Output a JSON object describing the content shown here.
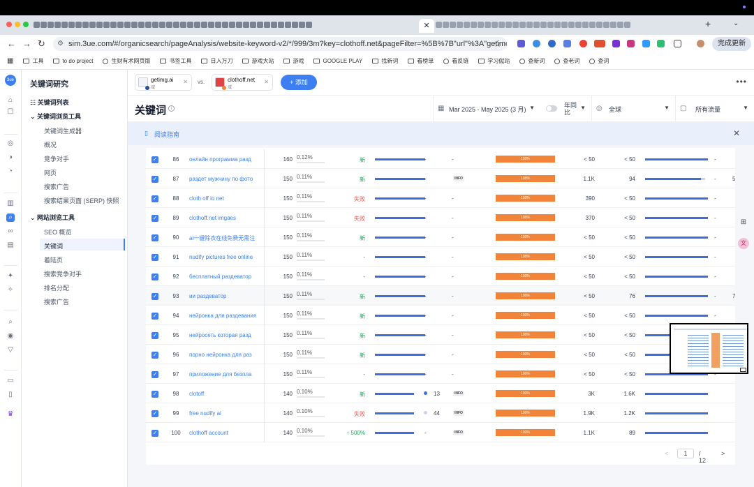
{
  "browser": {
    "url": "sim.3ue.com/#/organicsearch/pageAnalysis/website-keyword-v2/*/999/3m?key=clothoff.net&pageFilter=%5B%7B\"url\"%3A\"getimg.ai\"%2C\"sea...",
    "update_label": "完成更新",
    "active_tab_close": "✕",
    "new_tab": "+"
  },
  "bookmarks": [
    {
      "label": "工具",
      "icon": "folder-icon"
    },
    {
      "label": "to do project",
      "icon": "folder-icon"
    },
    {
      "label": "生财有术网页版",
      "icon": "globe-icon"
    },
    {
      "label": "书签工具",
      "icon": "folder-icon"
    },
    {
      "label": "日入万刀",
      "icon": "folder-icon"
    },
    {
      "label": "游戏大站",
      "icon": "folder-icon"
    },
    {
      "label": "游戏",
      "icon": "folder-icon"
    },
    {
      "label": "GOOGLE PLAY",
      "icon": "folder-icon"
    },
    {
      "label": "找新词",
      "icon": "folder-icon"
    },
    {
      "label": "看榜单",
      "icon": "folder-icon"
    },
    {
      "label": "看反链",
      "icon": "globe-icon"
    },
    {
      "label": "学习僦站",
      "icon": "folder-icon"
    },
    {
      "label": "查新词",
      "icon": "globe-icon"
    },
    {
      "label": "查老词",
      "icon": "globe-icon"
    },
    {
      "label": "查词",
      "icon": "globe-icon"
    }
  ],
  "sidebar": {
    "title": "关键词研究",
    "keyword_list": "关键词列表",
    "kw_browse_tools": "关键词浏览工具",
    "kw_tools": [
      "关键词生成器",
      "概况",
      "竞争对手",
      "网页",
      "搜索广告",
      "搜索结果页面 (SERP) 快照"
    ],
    "site_browse_tools": "网站浏览工具",
    "site_tools": [
      "SEO 概览",
      "关键词",
      "着陆页",
      "搜索竞争对手",
      "排名分配",
      "搜索广告"
    ]
  },
  "compare": {
    "site1": {
      "name": "getimg.ai",
      "sub": "域",
      "color": "#2c4a9a"
    },
    "vs": "vs.",
    "site2": {
      "name": "clothoff.net",
      "sub": "域",
      "color": "#f2843a"
    },
    "add_label": "+ 添加",
    "more": "•••"
  },
  "header": {
    "title": "关键词",
    "date_range": "Mar 2025 - May 2025 (3 月)",
    "yoy": "年同比",
    "region": "全球",
    "traffic": "所有流量"
  },
  "guide": {
    "label": "阅读指南"
  },
  "rows": [
    {
      "n": "86",
      "kw": "онлайн программа разд",
      "vol": "160",
      "share": "0.12%",
      "chg": "新",
      "chg_type": "new",
      "bar1": 72,
      "pos": "-",
      "pos_dot": "",
      "feat": "-",
      "info": false,
      "ob": "100%",
      "cpc": "< 50",
      "kd": "< 50",
      "bar2": 90,
      "bar2_tail": false,
      "d2": "-",
      "last": ""
    },
    {
      "n": "87",
      "kw": "раздет мужчину по фото",
      "vol": "150",
      "share": "0.11%",
      "chg": "新",
      "chg_type": "new",
      "bar1": 72,
      "pos": "-",
      "pos_dot": "",
      "feat": "",
      "info": true,
      "ob": "100%",
      "cpc": "1.1K",
      "kd": "94",
      "bar2": 80,
      "bar2_tail": true,
      "d2": "-",
      "last": "5"
    },
    {
      "n": "88",
      "kw": "cloth off io net",
      "vol": "150",
      "share": "0.11%",
      "chg": "失败",
      "chg_type": "lost",
      "bar1": 72,
      "pos": "-",
      "pos_dot": "",
      "feat": "-",
      "info": false,
      "ob": "100%",
      "cpc": "390",
      "kd": "< 50",
      "bar2": 90,
      "bar2_tail": false,
      "d2": "-",
      "last": ""
    },
    {
      "n": "89",
      "kw": "clothoff.net imgaes",
      "vol": "150",
      "share": "0.11%",
      "chg": "失败",
      "chg_type": "lost",
      "bar1": 72,
      "pos": "-",
      "pos_dot": "",
      "feat": "-",
      "info": false,
      "ob": "100%",
      "cpc": "370",
      "kd": "< 50",
      "bar2": 90,
      "bar2_tail": false,
      "d2": "-",
      "last": ""
    },
    {
      "n": "90",
      "kw": "ai一键除衣在线免费无需注",
      "vol": "150",
      "share": "0.11%",
      "chg": "新",
      "chg_type": "new",
      "bar1": 72,
      "pos": "-",
      "pos_dot": "",
      "feat": "-",
      "info": false,
      "ob": "100%",
      "cpc": "< 50",
      "kd": "< 50",
      "bar2": 90,
      "bar2_tail": false,
      "d2": "-",
      "last": ""
    },
    {
      "n": "91",
      "kw": "nudify pictures free online",
      "vol": "150",
      "share": "0.11%",
      "chg": "-",
      "chg_type": "dash",
      "bar1": 72,
      "pos": "-",
      "pos_dot": "",
      "feat": "-",
      "info": false,
      "ob": "100%",
      "cpc": "< 50",
      "kd": "< 50",
      "bar2": 90,
      "bar2_tail": false,
      "d2": "-",
      "last": ""
    },
    {
      "n": "92",
      "kw": "бесплатный раздеватор",
      "vol": "150",
      "share": "0.11%",
      "chg": "-",
      "chg_type": "dash",
      "bar1": 72,
      "pos": "-",
      "pos_dot": "",
      "feat": "-",
      "info": false,
      "ob": "100%",
      "cpc": "< 50",
      "kd": "< 50",
      "bar2": 90,
      "bar2_tail": false,
      "d2": "-",
      "last": ""
    },
    {
      "n": "93",
      "kw": "ии раздеватор",
      "vol": "150",
      "share": "0.11%",
      "chg": "新",
      "chg_type": "new",
      "bar1": 72,
      "pos": "-",
      "pos_dot": "",
      "feat": "-",
      "info": false,
      "ob": "100%",
      "cpc": "< 50",
      "kd": "76",
      "bar2": 90,
      "bar2_tail": false,
      "d2": "-",
      "last": "7"
    },
    {
      "n": "94",
      "kw": "нейронка для раздевания",
      "vol": "150",
      "share": "0.11%",
      "chg": "新",
      "chg_type": "new",
      "bar1": 72,
      "pos": "-",
      "pos_dot": "",
      "feat": "-",
      "info": false,
      "ob": "100%",
      "cpc": "< 50",
      "kd": "< 50",
      "bar2": 90,
      "bar2_tail": false,
      "d2": "-",
      "last": ""
    },
    {
      "n": "95",
      "kw": "нейросеть которая разд",
      "vol": "150",
      "share": "0.11%",
      "chg": "新",
      "chg_type": "new",
      "bar1": 72,
      "pos": "-",
      "pos_dot": "",
      "feat": "-",
      "info": false,
      "ob": "100%",
      "cpc": "< 50",
      "kd": "< 50",
      "bar2": 90,
      "bar2_tail": false,
      "d2": "-",
      "last": ""
    },
    {
      "n": "96",
      "kw": "порно нейронка для раз",
      "vol": "150",
      "share": "0.11%",
      "chg": "新",
      "chg_type": "new",
      "bar1": 72,
      "pos": "-",
      "pos_dot": "",
      "feat": "-",
      "info": false,
      "ob": "100%",
      "cpc": "< 50",
      "kd": "< 50",
      "bar2": 90,
      "bar2_tail": false,
      "d2": "-",
      "last": ""
    },
    {
      "n": "97",
      "kw": "приложение для безпла",
      "vol": "150",
      "share": "0.11%",
      "chg": "-",
      "chg_type": "dash",
      "bar1": 72,
      "pos": "-",
      "pos_dot": "",
      "feat": "-",
      "info": false,
      "ob": "100%",
      "cpc": "< 50",
      "kd": "< 50",
      "bar2": 90,
      "bar2_tail": false,
      "d2": "-",
      "last": ""
    },
    {
      "n": "98",
      "kw": "clotoff",
      "vol": "140",
      "share": "0.10%",
      "chg": "新",
      "chg_type": "new",
      "bar1": 56,
      "pos": "13",
      "pos_dot": "#3d6fd8",
      "feat": "",
      "info": true,
      "ob": "100%",
      "cpc": "3K",
      "kd": "1.6K",
      "bar2": 90,
      "bar2_tail": false,
      "d2": "",
      "last": ""
    },
    {
      "n": "99",
      "kw": "free nudify ai",
      "vol": "140",
      "share": "0.10%",
      "chg": "失败",
      "chg_type": "lost",
      "bar1": 56,
      "pos": "44",
      "pos_dot": "#c9d4ea",
      "feat": "",
      "info": true,
      "ob": "100%",
      "cpc": "1.9K",
      "kd": "1.2K",
      "bar2": 90,
      "bar2_tail": false,
      "d2": "",
      "last": ""
    },
    {
      "n": "100",
      "kw": "clothoff account",
      "vol": "140",
      "share": "0.10%",
      "chg": "↑ 500%",
      "chg_type": "up",
      "bar1": 56,
      "pos": "-",
      "pos_dot": "",
      "feat": "",
      "info": true,
      "ob": "100%",
      "cpc": "1.1K",
      "kd": "89",
      "bar2": 90,
      "bar2_tail": false,
      "d2": "",
      "last": ""
    }
  ],
  "pager": {
    "prev": "<",
    "current": "1",
    "of": "/ 12",
    "next": ">"
  },
  "info_tag": "INFO"
}
